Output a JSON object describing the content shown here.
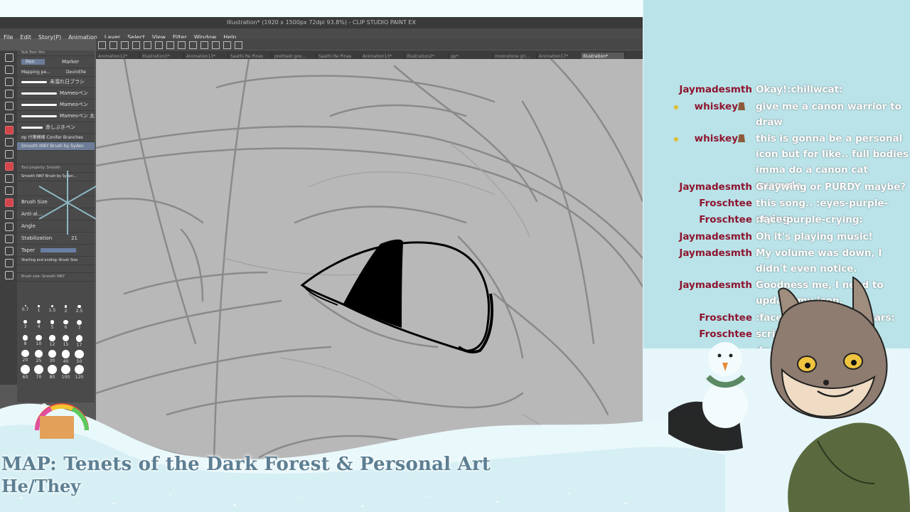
{
  "app": {
    "title": "Illustration* (1920 x 1500px 72dpi 93.8%) - CLIP STUDIO PAINT EX",
    "menu": [
      "File",
      "Edit",
      "Story(P)",
      "Animation",
      "Layer",
      "Select",
      "View",
      "Filter",
      "Window",
      "Help"
    ],
    "tabs": [
      "Animation12*",
      "Illustration3*",
      "Animation13*",
      "Saathi Re Pines",
      "prettiest goo...",
      "Saathi Re Pines",
      "Animation13*",
      "Illustration2*",
      "pp*",
      "moonstone gri...",
      "Animation17*",
      "Illustration*"
    ],
    "active_tab_index": 11
  },
  "subtool_panel": {
    "header": "Sub Tool: Pen",
    "tabs": [
      "Pen",
      "Marker"
    ],
    "tabs2": [
      "Mapping pe...",
      "DevinElle"
    ],
    "brushes": [
      "未溜れ日ブラシ",
      "Mameoペン",
      "Mameoペン",
      "Mameoペン 太",
      "赤しぶきペン",
      "σp 付葉模様 Conifer Branches",
      "Smooth INKY Brush by Syden"
    ],
    "tool_property_header": "Tool property: Smooth",
    "tool_property_name": "Smooth INKY Brush by Syden...",
    "brush_size_label": "Brush Size",
    "antialias_label": "Anti-al...",
    "angle_label": "Angle",
    "stabilization_label": "Stabilization",
    "stabilization_value": "21",
    "taper_label": "Taper",
    "starting_label": "Starting and ending: Brush Size",
    "brush_size_panel_header": "Brush size: Smooth INKY",
    "sizes": [
      "0.7",
      "1",
      "1.5",
      "2",
      "2.5",
      "3",
      "4",
      "5",
      "6",
      "7",
      "8",
      "10",
      "12",
      "15",
      "17",
      "20",
      "25",
      "30",
      "40",
      "50",
      "60",
      "70",
      "80",
      "100",
      "120"
    ]
  },
  "overlay": {
    "title": "MAP: Tenets of the Dark Forest & Personal Art",
    "pronouns": "He/They"
  },
  "chat": [
    {
      "user": "Jaymadesmth",
      "text": "Okay!:chillwcat:",
      "badge": false
    },
    {
      "user": "whiskey",
      "text": "give me a canon warrior to draw",
      "badge": true
    },
    {
      "user": "whiskey",
      "text": "this is gonna be a personal icon but for like.. full bodies imma do a canon cat example",
      "badge": true
    },
    {
      "user": "Jaymadesmth",
      "text": "Graywing or PURDY maybe?",
      "badge": false
    },
    {
      "user": "Froschtee",
      "text": "this song.. :eyes-purple-crying:",
      "badge": false
    },
    {
      "user": "Froschtee",
      "text": ":face-purple-crying:",
      "badge": false
    },
    {
      "user": "Jaymadesmth",
      "text": "Oh it's playing music!",
      "badge": false
    },
    {
      "user": "Jaymadesmth",
      "text": "My volume was down, I didn't even notice.",
      "badge": false
    },
    {
      "user": "Jaymadesmth",
      "text": "Goodness me, I need to update my icon.",
      "badge": false
    },
    {
      "user": "Froschtee",
      "text": ":face-purple-crying-tears:",
      "badge": false
    },
    {
      "user": "Froschtee",
      "text": "scribbles",
      "badge": false
    },
    {
      "user": "",
      "text": "done",
      "badge": false
    }
  ],
  "colors": {
    "chat_bg": "#b9e3e8",
    "username": "#8e1530",
    "overlay_text": "#5d7f93",
    "canvas": "#b8b8b8",
    "tool_panel": "#4a4a4a"
  }
}
